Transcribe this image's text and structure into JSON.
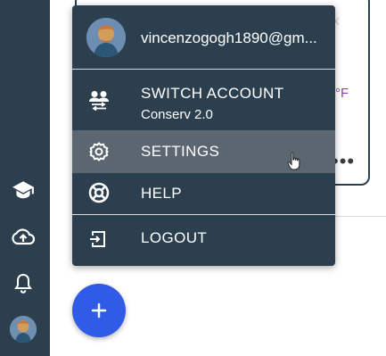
{
  "account": {
    "email": "vincenzogogh1890@gm..."
  },
  "menu": {
    "items": [
      {
        "label": "SWITCH ACCOUNT",
        "sublabel": "Conserv 2.0",
        "icon": "switch-account-icon"
      },
      {
        "label": "SETTINGS",
        "icon": "gear-icon"
      },
      {
        "label": "HELP",
        "icon": "help-lifebuoy-icon"
      },
      {
        "label": "LOGOUT",
        "icon": "logout-icon"
      }
    ]
  },
  "background": {
    "partial_text": "°F",
    "close_glyph": "×",
    "more_glyph": "•••"
  },
  "colors": {
    "sidebar": "#2b3f4e",
    "menu": "#2b3f4e",
    "menu_hover": "#5c6670",
    "fab": "#2f5be6",
    "accent_purple": "#8f45b6"
  }
}
